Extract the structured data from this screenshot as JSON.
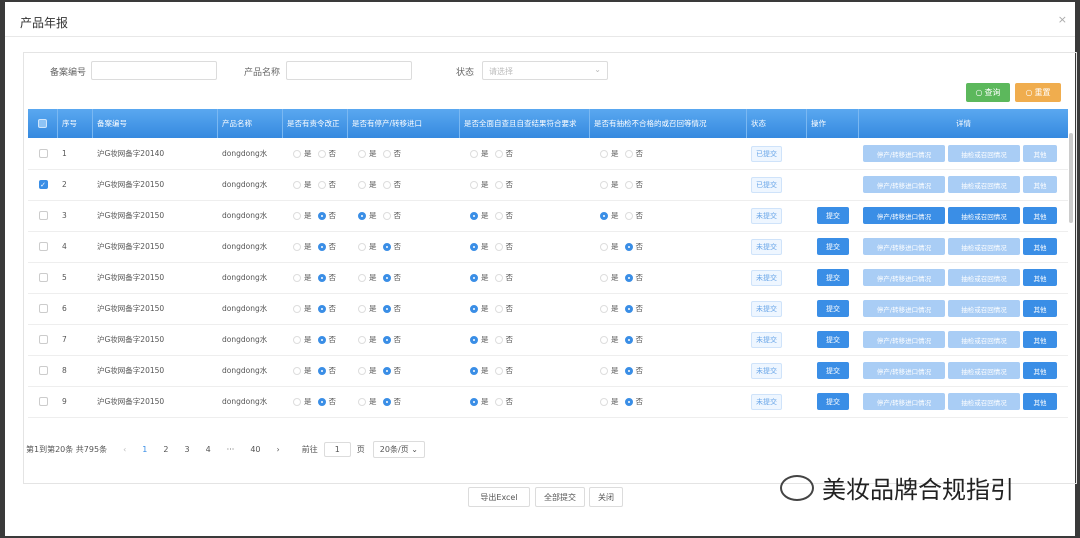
{
  "dialog": {
    "title": "产品年报",
    "close": "×"
  },
  "filters": {
    "record_no_label": "备案编号",
    "product_name_label": "产品名称",
    "status_label": "状态",
    "status_placeholder": "请选择"
  },
  "buttons": {
    "search": "查询",
    "reset": "重置"
  },
  "columns": [
    "序号",
    "备案编号",
    "产品名称",
    "是否有责令改正",
    "是否有停产/转移进口",
    "是否全面自查且自查结果符合要求",
    "是否有抽检不合格的或召回等情况",
    "状态",
    "操作",
    "详情"
  ],
  "radio": {
    "yes": "是",
    "no": "否"
  },
  "actions": {
    "submit": "提交",
    "detail1": "停产/转移进口情况",
    "detail2": "抽检或召回情况",
    "detail3": "其他"
  },
  "rows": [
    {
      "no": "1",
      "record": "沪G妆网备字20140",
      "name": "dongdong水",
      "r1": "none",
      "r2": "none",
      "r3": "none",
      "r4": "none",
      "status": "已提交",
      "submit": false,
      "detail_active": false,
      "checked": false
    },
    {
      "no": "2",
      "record": "沪G妆网备字20150",
      "name": "dongdong水",
      "r1": "none",
      "r2": "none",
      "r3": "none",
      "r4": "none",
      "status": "已提交",
      "submit": false,
      "detail_active": false,
      "checked": true
    },
    {
      "no": "3",
      "record": "沪G妆网备字20150",
      "name": "dongdong水",
      "r1": "no",
      "r2": "yes",
      "r3": "yes",
      "r4": "yes",
      "status": "未提交",
      "submit": true,
      "detail_active": true,
      "checked": false
    },
    {
      "no": "4",
      "record": "沪G妆网备字20150",
      "name": "dongdong水",
      "r1": "no",
      "r2": "no",
      "r3": "yes",
      "r4": "no",
      "status": "未提交",
      "submit": true,
      "detail_active": false,
      "checked": false
    },
    {
      "no": "5",
      "record": "沪G妆网备字20150",
      "name": "dongdong水",
      "r1": "no",
      "r2": "no",
      "r3": "yes",
      "r4": "no",
      "status": "未提交",
      "submit": true,
      "detail_active": false,
      "checked": false
    },
    {
      "no": "6",
      "record": "沪G妆网备字20150",
      "name": "dongdong水",
      "r1": "no",
      "r2": "no",
      "r3": "yes",
      "r4": "no",
      "status": "未提交",
      "submit": true,
      "detail_active": false,
      "checked": false
    },
    {
      "no": "7",
      "record": "沪G妆网备字20150",
      "name": "dongdong水",
      "r1": "no",
      "r2": "no",
      "r3": "yes",
      "r4": "no",
      "status": "未提交",
      "submit": true,
      "detail_active": false,
      "checked": false
    },
    {
      "no": "8",
      "record": "沪G妆网备字20150",
      "name": "dongdong水",
      "r1": "no",
      "r2": "no",
      "r3": "yes",
      "r4": "no",
      "status": "未提交",
      "submit": true,
      "detail_active": false,
      "checked": false
    },
    {
      "no": "9",
      "record": "沪G妆网备字20150",
      "name": "dongdong水",
      "r1": "no",
      "r2": "no",
      "r3": "yes",
      "r4": "no",
      "status": "未提交",
      "submit": true,
      "detail_active": false,
      "checked": false
    }
  ],
  "pager": {
    "summary": "第1到第20条 共795条",
    "prev": "‹",
    "next": "›",
    "pages": [
      "1",
      "2",
      "3",
      "4",
      "···",
      "40"
    ],
    "goto": "前往",
    "goto_value": "1",
    "page_unit": "页",
    "page_size": "20条/页"
  },
  "footer": {
    "export": "导出Excel",
    "submit_all": "全部提交",
    "close": "关闭"
  },
  "watermark": "美妆品牌合规指引"
}
